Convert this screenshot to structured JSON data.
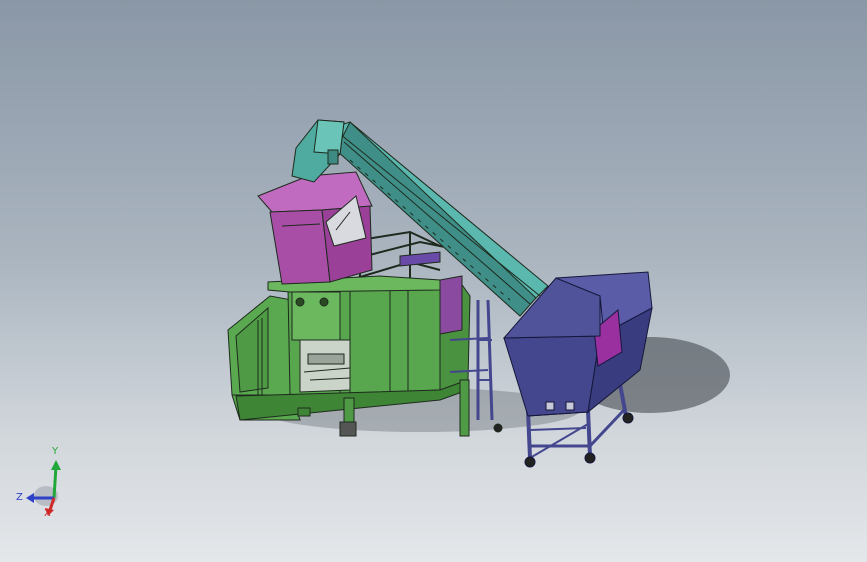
{
  "viewport": {
    "background_top": "#8a97a6",
    "background_bottom": "#e4e7ea"
  },
  "model": {
    "colors": {
      "frame_green": "#4f9a44",
      "frame_green_light": "#6bb85e",
      "hopper_magenta": "#a84ea6",
      "conveyor_teal": "#4fa9a0",
      "bin_navy": "#44468e",
      "bin_purple_panel": "#9a2fa0",
      "line": "#1e2a1e"
    }
  },
  "triad": {
    "y_label": "Y",
    "z_label": "Z",
    "x_label": "X",
    "y_color": "#22a83a",
    "z_color": "#2f40c8",
    "x_color": "#d02828"
  }
}
